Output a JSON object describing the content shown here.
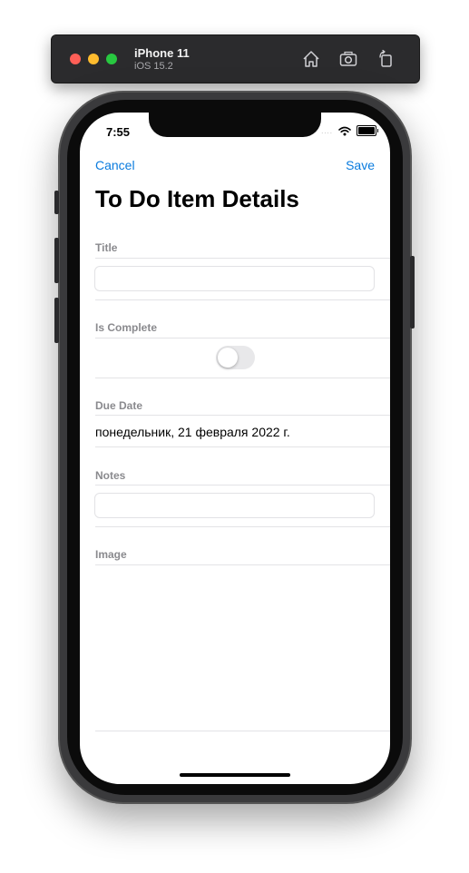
{
  "simulator": {
    "device_name": "iPhone 11",
    "os_version": "iOS 15.2",
    "toolbar_icons": [
      "home-icon",
      "screenshot-icon",
      "rotate-icon"
    ],
    "traffic_light_colors": [
      "#fe5f57",
      "#febc2e",
      "#28c840"
    ]
  },
  "status_bar": {
    "time": "7:55",
    "signal": "....",
    "icons": [
      "wifi-icon",
      "battery-icon"
    ]
  },
  "nav": {
    "cancel_label": "Cancel",
    "save_label": "Save",
    "accent_color": "#0a7bde"
  },
  "page_title": "To Do Item Details",
  "form": {
    "title": {
      "header": "Title",
      "value": "",
      "placeholder": ""
    },
    "is_complete": {
      "header": "Is Complete",
      "toggle_on": false
    },
    "due_date": {
      "header": "Due Date",
      "value": "понедельник, 21 февраля 2022 г."
    },
    "notes": {
      "header": "Notes",
      "value": "",
      "placeholder": ""
    },
    "image": {
      "header": "Image"
    }
  }
}
